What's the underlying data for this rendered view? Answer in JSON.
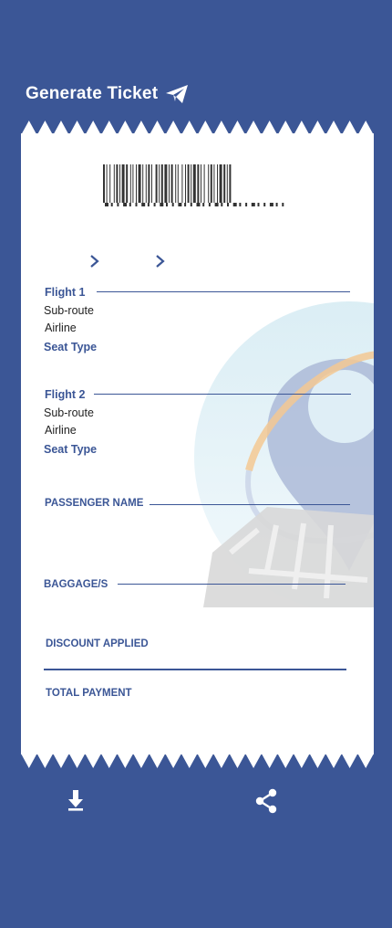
{
  "header": {
    "title": "Generate Ticket",
    "icon": "paper-plane-icon"
  },
  "ticket": {
    "route_chevrons": [
      "chevron-right-icon",
      "chevron-right-icon"
    ],
    "flights": [
      {
        "title": "Flight 1",
        "subroute": "Sub-route",
        "airline": "Airline",
        "seat_type": "Seat Type"
      },
      {
        "title": "Flight 2",
        "subroute": "Sub-route",
        "airline": "Airline",
        "seat_type": "Seat Type"
      }
    ],
    "passenger_label": "PASSENGER NAME",
    "baggage_label": "BAGGAGE/S",
    "discount_label": "DISCOUNT APPLIED",
    "total_label": "TOTAL PAYMENT"
  },
  "actions": {
    "download_icon": "download-icon",
    "share_icon": "share-icon"
  },
  "colors": {
    "background": "#3b5696",
    "ticket": "#ffffff",
    "accent": "#3b5696"
  }
}
